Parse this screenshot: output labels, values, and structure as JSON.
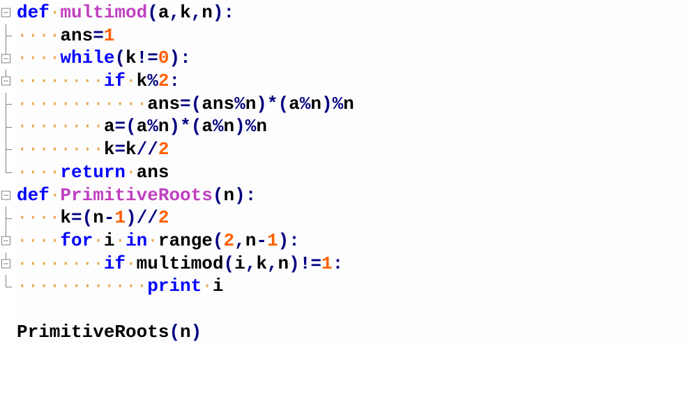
{
  "syntax_colors": {
    "keyword": "#0000ff",
    "function_name": "#c040c0",
    "identifier": "#000000",
    "operator_punct": "#000080",
    "number": "#ff6000",
    "whitespace_marker": "#e8a64d"
  },
  "whitespace_char": "·",
  "code_plain": "def multimod(a,k,n):\n    ans=1\n    while(k!=0):\n        if k%2:\n            ans=(ans%n)*(a%n)%n\n        a=(a%n)*(a%n)%n\n        k=k//2\n    return ans\ndef PrimitiveRoots(n):\n    k=(n-1)//2\n    for i in range(2,n-1):\n        if multimod(i,k,n)!=1:\n            print i\n\nPrimitiveRoots(n)",
  "lines": [
    {
      "indent": 0,
      "gutter": "fold",
      "tokens": [
        [
          "kw",
          "def"
        ],
        [
          "ws",
          " "
        ],
        [
          "fn",
          "multimod"
        ],
        [
          "op",
          "("
        ],
        [
          "id",
          "a"
        ],
        [
          "op",
          ","
        ],
        [
          "id",
          "k"
        ],
        [
          "op",
          ","
        ],
        [
          "id",
          "n"
        ],
        [
          "op",
          ")"
        ],
        [
          "op",
          ":"
        ]
      ]
    },
    {
      "indent": 4,
      "gutter": "tee",
      "tokens": [
        [
          "id",
          "ans"
        ],
        [
          "op",
          "="
        ],
        [
          "num",
          "1"
        ]
      ]
    },
    {
      "indent": 4,
      "gutter": "fold-with-line-above",
      "tokens": [
        [
          "kw",
          "while"
        ],
        [
          "op",
          "("
        ],
        [
          "id",
          "k"
        ],
        [
          "op",
          "!="
        ],
        [
          "num",
          "0"
        ],
        [
          "op",
          ")"
        ],
        [
          "op",
          ":"
        ]
      ]
    },
    {
      "indent": 8,
      "gutter": "fold-with-line-above",
      "tokens": [
        [
          "kw",
          "if"
        ],
        [
          "ws",
          " "
        ],
        [
          "id",
          "k"
        ],
        [
          "op",
          "%"
        ],
        [
          "num",
          "2"
        ],
        [
          "op",
          ":"
        ]
      ]
    },
    {
      "indent": 12,
      "gutter": "tee",
      "tokens": [
        [
          "id",
          "ans"
        ],
        [
          "op",
          "="
        ],
        [
          "op",
          "("
        ],
        [
          "id",
          "ans"
        ],
        [
          "op",
          "%"
        ],
        [
          "id",
          "n"
        ],
        [
          "op",
          ")"
        ],
        [
          "op",
          "*"
        ],
        [
          "op",
          "("
        ],
        [
          "id",
          "a"
        ],
        [
          "op",
          "%"
        ],
        [
          "id",
          "n"
        ],
        [
          "op",
          ")"
        ],
        [
          "op",
          "%"
        ],
        [
          "id",
          "n"
        ]
      ]
    },
    {
      "indent": 8,
      "gutter": "tee",
      "tokens": [
        [
          "id",
          "a"
        ],
        [
          "op",
          "="
        ],
        [
          "op",
          "("
        ],
        [
          "id",
          "a"
        ],
        [
          "op",
          "%"
        ],
        [
          "id",
          "n"
        ],
        [
          "op",
          ")"
        ],
        [
          "op",
          "*"
        ],
        [
          "op",
          "("
        ],
        [
          "id",
          "a"
        ],
        [
          "op",
          "%"
        ],
        [
          "id",
          "n"
        ],
        [
          "op",
          ")"
        ],
        [
          "op",
          "%"
        ],
        [
          "id",
          "n"
        ]
      ]
    },
    {
      "indent": 8,
      "gutter": "tee",
      "tokens": [
        [
          "id",
          "k"
        ],
        [
          "op",
          "="
        ],
        [
          "id",
          "k"
        ],
        [
          "op",
          "//"
        ],
        [
          "num",
          "2"
        ]
      ]
    },
    {
      "indent": 4,
      "gutter": "corner",
      "tokens": [
        [
          "kw",
          "return"
        ],
        [
          "ws",
          " "
        ],
        [
          "id",
          "ans"
        ]
      ]
    },
    {
      "indent": 0,
      "gutter": "fold",
      "tokens": [
        [
          "kw",
          "def"
        ],
        [
          "ws",
          " "
        ],
        [
          "fn",
          "PrimitiveRoots"
        ],
        [
          "op",
          "("
        ],
        [
          "id",
          "n"
        ],
        [
          "op",
          ")"
        ],
        [
          "op",
          ":"
        ]
      ]
    },
    {
      "indent": 4,
      "gutter": "tee",
      "tokens": [
        [
          "id",
          "k"
        ],
        [
          "op",
          "="
        ],
        [
          "op",
          "("
        ],
        [
          "id",
          "n"
        ],
        [
          "op",
          "-"
        ],
        [
          "num",
          "1"
        ],
        [
          "op",
          ")"
        ],
        [
          "op",
          "//"
        ],
        [
          "num",
          "2"
        ]
      ]
    },
    {
      "indent": 4,
      "gutter": "fold-with-line-above",
      "tokens": [
        [
          "kw",
          "for"
        ],
        [
          "ws",
          " "
        ],
        [
          "id",
          "i"
        ],
        [
          "ws",
          " "
        ],
        [
          "kw",
          "in"
        ],
        [
          "ws",
          " "
        ],
        [
          "id",
          "range"
        ],
        [
          "op",
          "("
        ],
        [
          "num",
          "2"
        ],
        [
          "op",
          ","
        ],
        [
          "id",
          "n"
        ],
        [
          "op",
          "-"
        ],
        [
          "num",
          "1"
        ],
        [
          "op",
          ")"
        ],
        [
          "op",
          ":"
        ]
      ]
    },
    {
      "indent": 8,
      "gutter": "fold-with-line-above",
      "tokens": [
        [
          "kw",
          "if"
        ],
        [
          "ws",
          " "
        ],
        [
          "id",
          "multimod"
        ],
        [
          "op",
          "("
        ],
        [
          "id",
          "i"
        ],
        [
          "op",
          ","
        ],
        [
          "id",
          "k"
        ],
        [
          "op",
          ","
        ],
        [
          "id",
          "n"
        ],
        [
          "op",
          ")"
        ],
        [
          "op",
          "!="
        ],
        [
          "num",
          "1"
        ],
        [
          "op",
          ":"
        ]
      ]
    },
    {
      "indent": 12,
      "gutter": "corner",
      "tokens": [
        [
          "kw",
          "print"
        ],
        [
          "ws",
          " "
        ],
        [
          "id",
          "i"
        ]
      ]
    },
    {
      "indent": 0,
      "gutter": "none",
      "tokens": []
    },
    {
      "indent": 0,
      "gutter": "none",
      "tokens": [
        [
          "id",
          "PrimitiveRoots"
        ],
        [
          "op",
          "("
        ],
        [
          "id",
          "n"
        ],
        [
          "op",
          ")"
        ]
      ]
    }
  ]
}
